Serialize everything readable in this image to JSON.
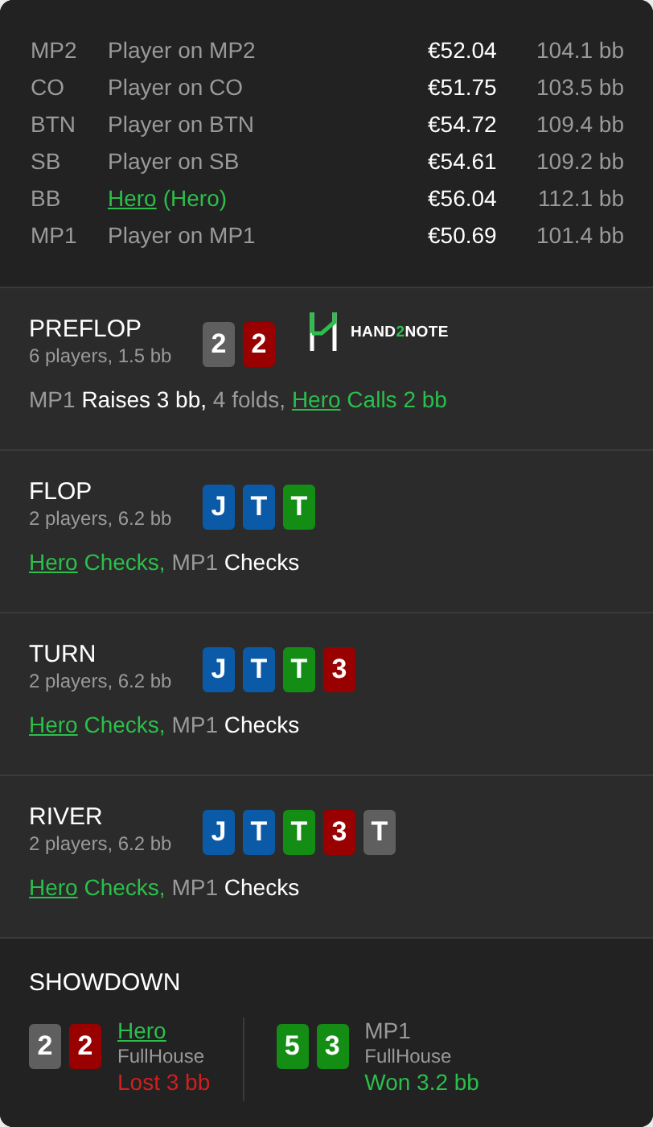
{
  "players": [
    {
      "position": "MP2",
      "name": "Player on MP2",
      "hero": false,
      "stack": "€52.04",
      "bb": "104.1 bb"
    },
    {
      "position": "CO",
      "name": "Player on CO",
      "hero": false,
      "stack": "€51.75",
      "bb": "103.5 bb"
    },
    {
      "position": "BTN",
      "name": "Player on BTN",
      "hero": false,
      "stack": "€54.72",
      "bb": "109.4 bb"
    },
    {
      "position": "SB",
      "name": "Player on SB",
      "hero": false,
      "stack": "€54.61",
      "bb": "109.2 bb"
    },
    {
      "position": "BB",
      "name": "Hero",
      "note": "(Hero)",
      "hero": true,
      "stack": "€56.04",
      "bb": "112.1 bb"
    },
    {
      "position": "MP1",
      "name": "Player on MP1",
      "hero": false,
      "stack": "€50.69",
      "bb": "101.4 bb"
    }
  ],
  "streets": [
    {
      "title": "PREFLOP",
      "info": "6 players, 1.5 bb",
      "cards": [
        {
          "rank": "2",
          "color": "#5f5f5f"
        },
        {
          "rank": "2",
          "color": "#990000"
        }
      ],
      "logo": [
        {
          "text": "HAND",
          "accent": false
        },
        {
          "text": "2",
          "accent": true
        },
        {
          "text": "NOTE",
          "accent": false
        }
      ],
      "action": [
        {
          "kind": "player",
          "text": "MP1 "
        },
        {
          "kind": "action",
          "text": "Raises 3 bb,"
        },
        {
          "kind": "muted",
          "text": " 4 folds, "
        },
        {
          "kind": "hero",
          "text": "Hero"
        },
        {
          "kind": "hero-action",
          "text": " Calls 2 bb"
        }
      ]
    },
    {
      "title": "FLOP",
      "info": "2 players, 6.2 bb",
      "cards": [
        {
          "rank": "J",
          "color": "#0b5aa8"
        },
        {
          "rank": "T",
          "color": "#0b5aa8"
        },
        {
          "rank": "T",
          "color": "#138d13"
        }
      ],
      "action": [
        {
          "kind": "hero",
          "text": "Hero"
        },
        {
          "kind": "hero-action",
          "text": " Checks, "
        },
        {
          "kind": "player",
          "text": "MP1 "
        },
        {
          "kind": "action",
          "text": "Checks"
        }
      ]
    },
    {
      "title": "TURN",
      "info": "2 players, 6.2 bb",
      "cards": [
        {
          "rank": "J",
          "color": "#0b5aa8"
        },
        {
          "rank": "T",
          "color": "#0b5aa8"
        },
        {
          "rank": "T",
          "color": "#138d13"
        },
        {
          "rank": "3",
          "color": "#990000"
        }
      ],
      "action": [
        {
          "kind": "hero",
          "text": "Hero"
        },
        {
          "kind": "hero-action",
          "text": " Checks, "
        },
        {
          "kind": "player",
          "text": "MP1 "
        },
        {
          "kind": "action",
          "text": "Checks"
        }
      ]
    },
    {
      "title": "RIVER",
      "info": "2 players, 6.2 bb",
      "cards": [
        {
          "rank": "J",
          "color": "#0b5aa8"
        },
        {
          "rank": "T",
          "color": "#0b5aa8"
        },
        {
          "rank": "T",
          "color": "#138d13"
        },
        {
          "rank": "3",
          "color": "#990000"
        },
        {
          "rank": "T",
          "color": "#5f5f5f"
        }
      ],
      "action": [
        {
          "kind": "hero",
          "text": "Hero"
        },
        {
          "kind": "hero-action",
          "text": " Checks, "
        },
        {
          "kind": "player",
          "text": "MP1 "
        },
        {
          "kind": "action",
          "text": "Checks"
        }
      ]
    }
  ],
  "showdown": {
    "title": "SHOWDOWN",
    "hands": [
      {
        "cards": [
          {
            "rank": "2",
            "color": "#5f5f5f"
          },
          {
            "rank": "2",
            "color": "#990000"
          }
        ],
        "player": "Hero",
        "hero": true,
        "hand": "FullHouse",
        "result": "Lost 3 bb",
        "won": false
      },
      {
        "cards": [
          {
            "rank": "5",
            "color": "#138d13"
          },
          {
            "rank": "3",
            "color": "#138d13"
          }
        ],
        "player": "MP1",
        "hero": false,
        "hand": "FullHouse",
        "result": "Won 3.2 bb",
        "won": true
      }
    ]
  }
}
